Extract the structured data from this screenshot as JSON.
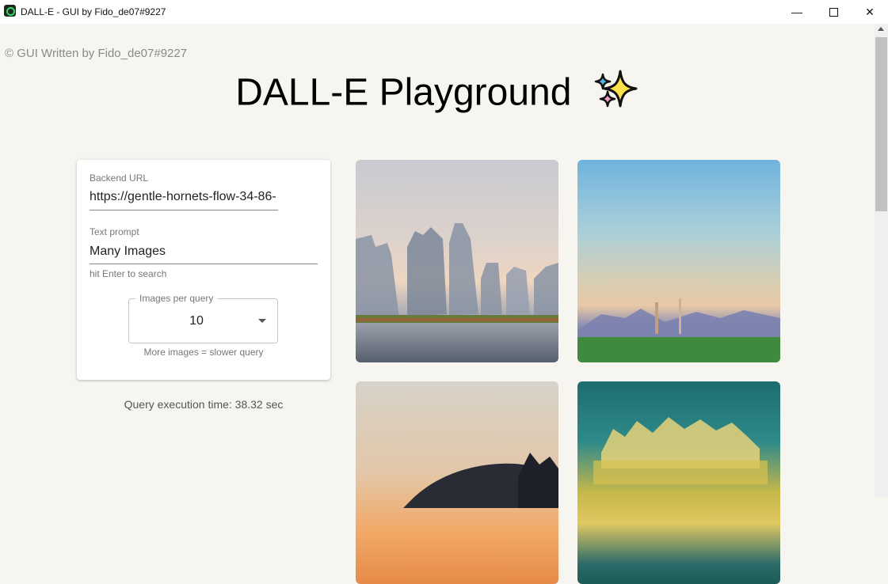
{
  "window": {
    "title": "DALL-E - GUI by Fido_de07#9227",
    "minimize_glyph": "—",
    "close_glyph": "✕"
  },
  "credit": "© GUI Written by Fido_de07#9227",
  "title": "DALL-E Playground",
  "form": {
    "backend_url_label": "Backend URL",
    "backend_url_value": "https://gentle-hornets-flow-34-86-",
    "text_prompt_label": "Text prompt",
    "text_prompt_value": "Many Images",
    "text_prompt_helper": "hit Enter to search",
    "images_per_query_label": "Images per query",
    "images_per_query_value": "10",
    "images_per_query_helper": "More images = slower query"
  },
  "query_time": "Query execution time: 38.32 sec",
  "colors": {
    "background": "#f6f5ef",
    "card": "#ffffff",
    "sparkle_yellow": "#ffe14a",
    "sparkle_blue": "#4cb8e8",
    "sparkle_pink": "#f4a0c8"
  },
  "icons": {
    "sparkle": "sparkles-icon"
  }
}
